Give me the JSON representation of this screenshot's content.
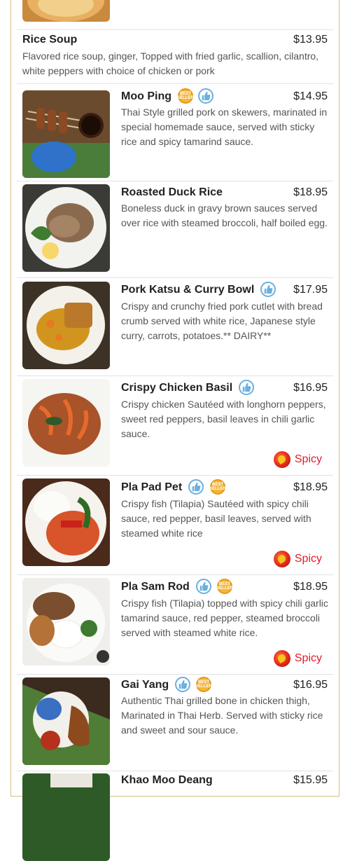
{
  "menu": {
    "rice_soup": {
      "name": "Rice Soup",
      "price": "$13.95",
      "description": "Flavored rice soup, ginger, Topped with fried garlic, scallion, cilantro, white peppers with choice of chicken or pork"
    },
    "items": [
      {
        "name": "Moo Ping",
        "price": "$14.95",
        "description": "Thai Style grilled pork on skewers, marinated in special homemade sauce, served with sticky rice and spicy tamarind sauce.",
        "badges": [
          "best-seller",
          "thumbs-up"
        ],
        "spicy": false
      },
      {
        "name": "Roasted Duck Rice",
        "price": "$18.95",
        "description": "Boneless duck in gravy brown sauces served over rice with steamed broccoli, half boiled egg.",
        "badges": [],
        "spicy": false
      },
      {
        "name": "Pork Katsu & Curry Bowl",
        "price": "$17.95",
        "description": "Crispy and crunchy fried pork cutlet with bread crumb served with white rice, Japanese style curry, carrots, potatoes.** DAIRY**",
        "badges": [
          "thumbs-up"
        ],
        "spicy": false
      },
      {
        "name": "Crispy Chicken Basil",
        "price": "$16.95",
        "description": "Crispy chicken Sautéed with longhorn peppers, sweet red peppers, basil leaves in chili garlic sauce.",
        "badges": [
          "thumbs-up"
        ],
        "spicy": true
      },
      {
        "name": "Pla Pad Pet",
        "price": "$18.95",
        "description": "Crispy fish (Tilapia) Sautéed with spicy chili sauce, red pepper, basil leaves, served with steamed white rice",
        "badges": [
          "thumbs-up",
          "best-seller"
        ],
        "spicy": true
      },
      {
        "name": "Pla Sam Rod",
        "price": "$18.95",
        "description": "Crispy fish (Tilapia) topped with spicy chili garlic tamarind sauce, red pepper, steamed broccoli served with steamed white rice.",
        "badges": [
          "thumbs-up",
          "best-seller"
        ],
        "spicy": true
      },
      {
        "name": "Gai Yang",
        "price": "$16.95",
        "description": "Authentic Thai grilled bone in chicken thigh, Marinated in Thai Herb. Served with sticky rice and sweet and sour sauce.",
        "badges": [
          "thumbs-up",
          "best-seller"
        ],
        "spicy": false
      },
      {
        "name": "Khao Moo Deang",
        "price": "$15.95",
        "description": "",
        "badges": [],
        "spicy": false
      }
    ],
    "spicy_label": "Spicy",
    "best_seller_text": "BEST SELLER",
    "colors": {
      "frame_border": "#d4c07a",
      "spicy": "#e3192b",
      "thumbs_up": "#6ab0de",
      "best_seller": "#f4b53a"
    }
  }
}
